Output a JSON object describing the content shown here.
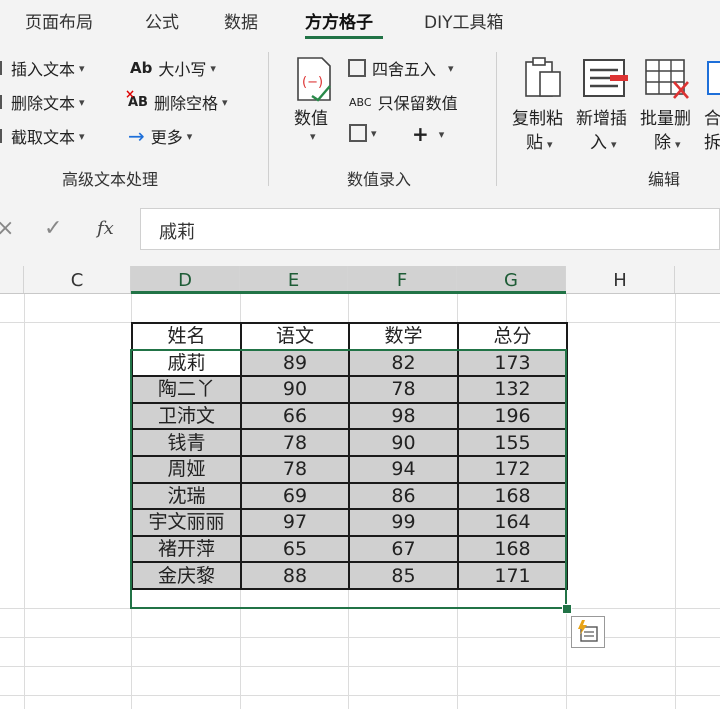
{
  "tabs": [
    "页面布局",
    "公式",
    "数据",
    "方方格子",
    "DIY工具箱"
  ],
  "active_tab": "方方格子",
  "ribbon": {
    "text_group": {
      "items": [
        "插入文本",
        "删除文本",
        "截取文本"
      ],
      "case_label": "大小写",
      "case_icon_text": "Ab",
      "trim_label": "删除空格",
      "trim_icon_text": "AB",
      "more_label": "更多",
      "group_label": "高级文本处理"
    },
    "value_group": {
      "big_label": "数值",
      "round_label": "四舍五入",
      "keep_label": "只保留数值",
      "keep_icon_text": "ABC",
      "plus_label": "+",
      "group_label": "数值录入"
    },
    "edit_group": {
      "copy_label_1": "复制粘",
      "copy_label_2": "贴",
      "insert_label_1": "新增插",
      "insert_label_2": "入",
      "batch_label_1": "批量删",
      "batch_label_2": "除",
      "merge_label_1": "合",
      "merge_label_2": "拆",
      "group_label": "编辑"
    }
  },
  "formula_bar": {
    "cancel": "×",
    "confirm": "✓",
    "fx": "fx",
    "value": "戚莉"
  },
  "columns": [
    "C",
    "D",
    "E",
    "F",
    "G",
    "H"
  ],
  "table": {
    "headers": [
      "姓名",
      "语文",
      "数学",
      "总分"
    ],
    "rows": [
      [
        "戚莉",
        "89",
        "82",
        "173"
      ],
      [
        "陶二丫",
        "90",
        "78",
        "132"
      ],
      [
        "卫沛文",
        "66",
        "98",
        "196"
      ],
      [
        "钱青",
        "78",
        "90",
        "155"
      ],
      [
        "周娅",
        "78",
        "94",
        "172"
      ],
      [
        "沈瑞",
        "69",
        "86",
        "168"
      ],
      [
        "宇文丽丽",
        "97",
        "99",
        "164"
      ],
      [
        "褚开萍",
        "65",
        "67",
        "168"
      ],
      [
        "金庆黎",
        "88",
        "85",
        "171"
      ]
    ]
  },
  "colors": {
    "accent": "#217346",
    "selection_fill": "#d0d0d0"
  },
  "icons": [
    "insert-text-icon",
    "delete-text-icon",
    "extract-text-icon",
    "arrow-right-icon",
    "numeric-icon",
    "round-icon",
    "keep-values-icon",
    "edit-cell-icon",
    "copy-paste-icon",
    "insert-rows-icon",
    "batch-delete-icon",
    "quick-analysis-icon"
  ]
}
